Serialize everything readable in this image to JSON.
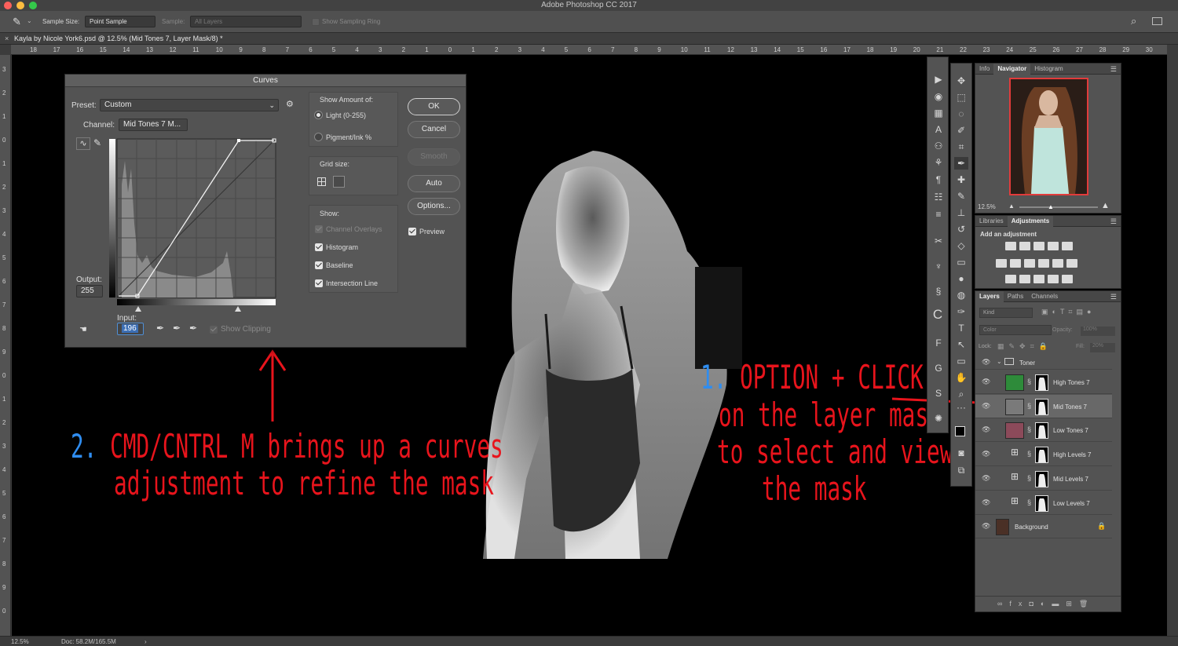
{
  "app": {
    "window_title": "Adobe Photoshop CC 2017"
  },
  "options_bar": {
    "sample_size_label": "Sample Size:",
    "sample_size_value": "Point Sample",
    "sample_label": "Sample:",
    "sample_value": "All Layers",
    "sampling_ring_label": "Show Sampling Ring"
  },
  "document": {
    "tab_title": "Kayla by Nicole York6.psd @ 12.5% (Mid Tones 7, Layer Mask/8) *"
  },
  "ruler_h": [
    "18",
    "17",
    "16",
    "15",
    "14",
    "13",
    "12",
    "11",
    "10",
    "9",
    "8",
    "7",
    "6",
    "5",
    "4",
    "3",
    "2",
    "1",
    "0",
    "1",
    "2",
    "3",
    "4",
    "5",
    "6",
    "7",
    "8",
    "9",
    "10",
    "11",
    "12",
    "13",
    "14",
    "15",
    "16",
    "17",
    "18",
    "19",
    "20",
    "21",
    "22",
    "23",
    "24",
    "25",
    "26",
    "27",
    "28",
    "29",
    "30"
  ],
  "ruler_v": [
    "3",
    "2",
    "1",
    "0",
    "1",
    "2",
    "3",
    "4",
    "5",
    "6",
    "7",
    "8",
    "9",
    "0",
    "1",
    "2",
    "3",
    "4",
    "5",
    "6",
    "7",
    "8",
    "9",
    "0"
  ],
  "curves": {
    "title": "Curves",
    "preset_label": "Preset:",
    "preset_value": "Custom",
    "channel_label": "Channel:",
    "channel_value": "Mid Tones 7 M...",
    "output_label": "Output:",
    "output_value": "255",
    "input_label": "Input:",
    "input_value": "196",
    "show_clipping": "Show Clipping",
    "show_amount_label": "Show Amount of:",
    "light_label": "Light  (0-255)",
    "pigment_label": "Pigment/Ink %",
    "grid_size_label": "Grid size:",
    "show_label": "Show:",
    "channel_overlays": "Channel Overlays",
    "histogram": "Histogram",
    "baseline": "Baseline",
    "intersection_line": "Intersection Line",
    "ok": "OK",
    "cancel": "Cancel",
    "smooth": "Smooth",
    "auto": "Auto",
    "options": "Options...",
    "preview": "Preview"
  },
  "annotations": {
    "a2_num": "2.",
    "a2_line1": " CMD/CNTRL M brings up a curves",
    "a2_line2": "adjustment to refine the mask",
    "a1_num": "1.",
    "a1_line1": " OPTION + CLICK",
    "a1_line2": "on the layer mask",
    "a1_line3": "to select and view",
    "a1_line4": "the mask"
  },
  "panels": {
    "top_tabs": [
      "Info",
      "Navigator",
      "Histogram"
    ],
    "zoom": "12.5%",
    "mid_tabs": [
      "Libraries",
      "Adjustments"
    ],
    "add_adjustment": "Add an adjustment",
    "layer_tabs": [
      "Layers",
      "Paths",
      "Channels"
    ],
    "kind": "Kind",
    "blend_mode": "Color",
    "opacity_label": "Opacity:",
    "opacity_value": "100%",
    "lock_label": "Lock:",
    "fill_label": "Fill:",
    "fill_value": "20%",
    "group_name": "Toner",
    "layers": [
      {
        "name": "High Tones 7",
        "color": "#2e8b3a"
      },
      {
        "name": "Mid Tones 7",
        "color": "#7a7a7a"
      },
      {
        "name": "Low Tones 7",
        "color": "#8c4a5a"
      },
      {
        "name": "High Levels 7",
        "color": ""
      },
      {
        "name": "Mid Levels 7",
        "color": ""
      },
      {
        "name": "Low Levels 7",
        "color": ""
      }
    ],
    "background_layer": "Background"
  },
  "status": {
    "zoom": "12.5%",
    "doc": "Doc: 58.2M/165.5M"
  },
  "colors": {
    "annotation_red": "#e8141c",
    "annotation_blue": "#2f8df0"
  }
}
